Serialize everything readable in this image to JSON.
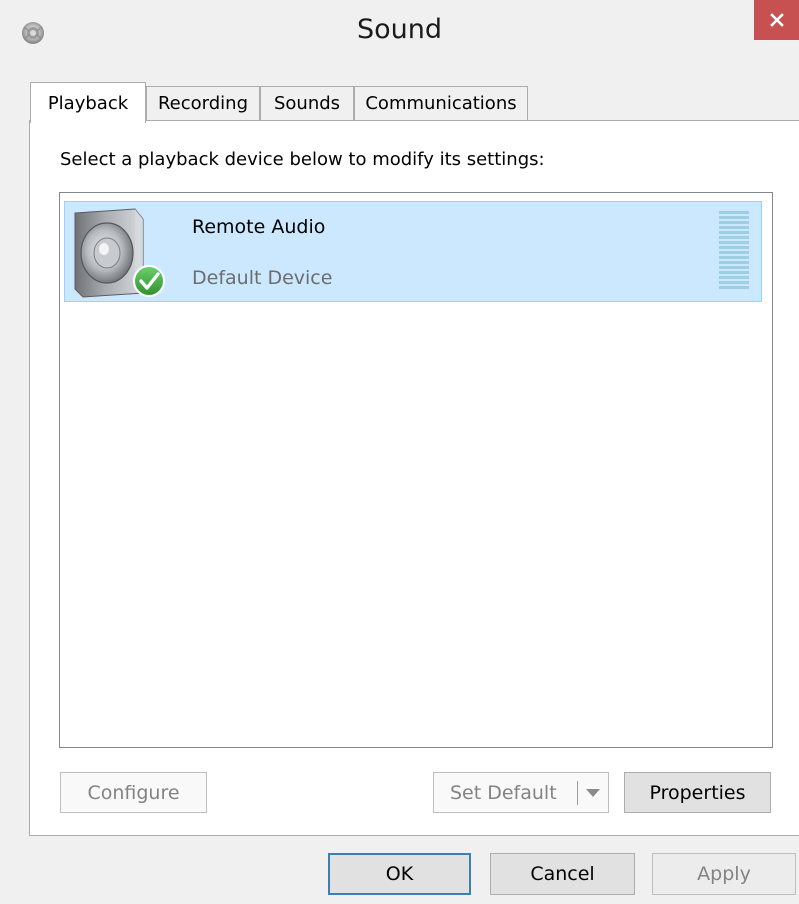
{
  "window": {
    "title": "Sound",
    "close_glyph": "×",
    "app_icon": "sound-icon"
  },
  "tabs": [
    {
      "label": "Playback",
      "active": true
    },
    {
      "label": "Recording",
      "active": false
    },
    {
      "label": "Sounds",
      "active": false
    },
    {
      "label": "Communications",
      "active": false
    }
  ],
  "panel": {
    "instruction": "Select a playback device below to modify its settings:",
    "devices": [
      {
        "name": "Remote Audio",
        "status": "Default Device",
        "icon": "speaker-icon",
        "default_badge": "check-icon",
        "selected": true
      }
    ],
    "buttons": {
      "configure": "Configure",
      "set_default": "Set Default",
      "properties": "Properties"
    }
  },
  "footer": {
    "ok": "OK",
    "cancel": "Cancel",
    "apply": "Apply"
  },
  "colors": {
    "selection": "#cce8ff",
    "selection_border": "#99d1ff",
    "close_button": "#c75050",
    "default_button_border": "#3c7fb1",
    "default_badge": "#3aa13a"
  }
}
